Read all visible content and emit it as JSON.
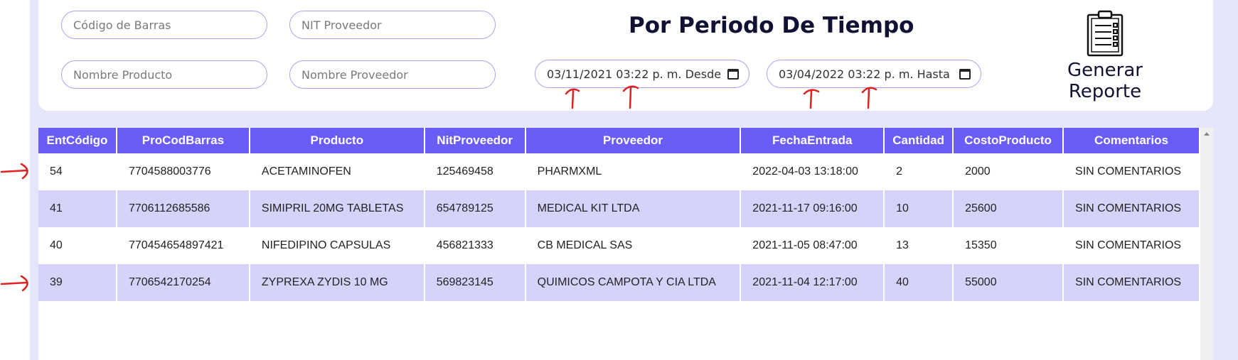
{
  "filters": {
    "barcode_placeholder": "Código de Barras",
    "nit_placeholder": "NIT Proveedor",
    "product_placeholder": "Nombre Producto",
    "supplier_placeholder": "Nombre Proveedor",
    "date_from_value": "03/11/2021 03:22 p. m.",
    "date_from_label": "Desde",
    "date_to_value": "03/04/2022 03:22 p. m.",
    "date_to_label": "Hasta"
  },
  "title": "Por Periodo De Tiempo",
  "report_button_label": "Generar Reporte",
  "report_icon": "clipboard-checklist-icon",
  "colors": {
    "accent": "#6a5cf6",
    "row_alt": "#d6d3fb",
    "background": "#e6e6fa",
    "annotation": "#e02020"
  },
  "table": {
    "headers": [
      "EntCódigo",
      "ProCodBarras",
      "Producto",
      "NitProveedor",
      "Proveedor",
      "FechaEntrada",
      "Cantidad",
      "CostoProducto",
      "Comentarios"
    ],
    "rows": [
      [
        "54",
        "7704588003776",
        "ACETAMINOFEN",
        "125469458",
        "PHARMXML",
        "2022-04-03 13:18:00",
        "2",
        "2000",
        "SIN COMENTARIOS"
      ],
      [
        "41",
        "7706112685586",
        "SIMIPRIL 20MG TABLETAS",
        "654789125",
        "MEDICAL KIT LTDA",
        "2021-11-17 09:16:00",
        "10",
        "25600",
        "SIN COMENTARIOS"
      ],
      [
        "40",
        "770454654897421",
        "NIFEDIPINO CAPSULAS",
        "456821333",
        "CB MEDICAL SAS",
        "2021-11-05 08:47:00",
        "13",
        "15350",
        "SIN COMENTARIOS"
      ],
      [
        "39",
        "7706542170254",
        "ZYPREXA ZYDIS 10 MG",
        "569823145",
        "QUIMICOS CAMPOTA Y CIA LTDA",
        "2021-11-04 12:17:00",
        "40",
        "55000",
        "SIN COMENTARIOS"
      ]
    ]
  }
}
